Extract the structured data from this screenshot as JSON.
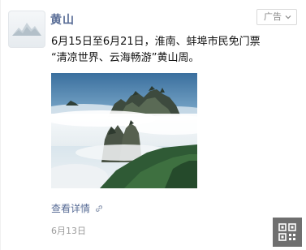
{
  "account": {
    "name": "黄山",
    "avatar_caption": "黄山风景区"
  },
  "ad_tag": {
    "label": "广告",
    "icon": "chevron-down-icon"
  },
  "post": {
    "text_line1": "6月15日至6月21日，淮南、蚌埠市民免门票",
    "text_line2": "“清凉世界、云海畅游”黄山周。",
    "image_description_icon": "photo",
    "details_label": "查看详情",
    "details_icon": "link-icon",
    "date": "6月13日"
  },
  "toolbar": {
    "qr_icon": "qr-code-icon"
  },
  "colors": {
    "link": "#576b95",
    "text": "#111111",
    "muted": "#9b9b9b",
    "qr_bg": "#6f6f6f"
  }
}
